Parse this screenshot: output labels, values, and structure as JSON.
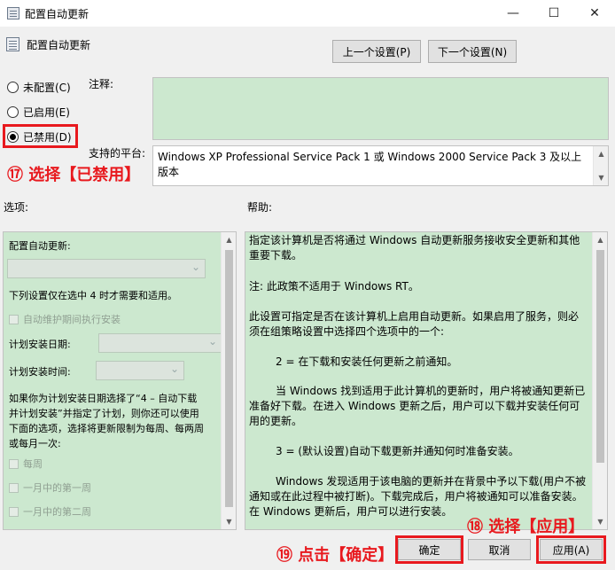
{
  "window": {
    "title": "配置自动更新",
    "min": "—",
    "max": "☐",
    "close": "✕"
  },
  "header": {
    "policy_title": "配置自动更新",
    "prev_button": "上一个设置(P)",
    "next_button": "下一个设置(N)"
  },
  "state": {
    "options": [
      {
        "label": "未配置(C)",
        "checked": false
      },
      {
        "label": "已启用(E)",
        "checked": false
      },
      {
        "label": "已禁用(D)",
        "checked": true
      }
    ]
  },
  "comment": {
    "label": "注释:",
    "value": ""
  },
  "platform": {
    "label": "支持的平台:",
    "value": "Windows XP Professional Service Pack 1 或 Windows 2000 Service Pack 3 及以上版本"
  },
  "options_label": "选项:",
  "help_label": "帮助:",
  "options": {
    "configure_label": "配置自动更新:",
    "configure_value": "",
    "note": "下列设置仅在选中 4 时才需要和适用。",
    "maintenance_checkbox": "自动维护期间执行安装",
    "schedule_day_label": "计划安装日期:",
    "schedule_time_label": "计划安装时间:",
    "paragraph_lines": [
      "如果你为计划安装日期选择了“4 – 自动下载",
      "并计划安装”并指定了计划，则你还可以使用",
      "下面的选项，选择将更新限制为每周、每两周",
      "或每月一次:"
    ],
    "weekly": "每周",
    "first_week": "一月中的第一周",
    "second_week": "一月中的第二周"
  },
  "help": {
    "paragraphs": [
      "指定该计算机是否将通过 Windows 自动更新服务接收安全更新和其他重要下载。",
      "注: 此政策不适用于 Windows RT。",
      "此设置可指定是否在该计算机上启用自动更新。如果启用了服务，则必须在组策略设置中选择四个选项中的一个:",
      "2 = 在下载和安装任何更新之前通知。",
      "当 Windows 找到适用于此计算机的更新时，用户将被通知更新已准备好下载。在进入 Windows 更新之后，用户可以下载并安装任何可用的更新。",
      "3 = (默认设置)自动下载更新并通知何时准备安装。",
      "Windows 发现适用于该电脑的更新并在背景中予以下载(用户不被通知或在此过程中被打断)。下载完成后，用户将被通知可以准备安装。在 Windows 更新后，用户可以进行安装。"
    ]
  },
  "buttons": {
    "ok": "确定",
    "cancel": "取消",
    "apply": "应用(A)"
  },
  "annotations": {
    "step17": "⑰ 选择【已禁用】",
    "step18": "⑱ 选择【应用】",
    "step19": "⑲ 点击【确定】",
    "color": "#e8191e"
  }
}
